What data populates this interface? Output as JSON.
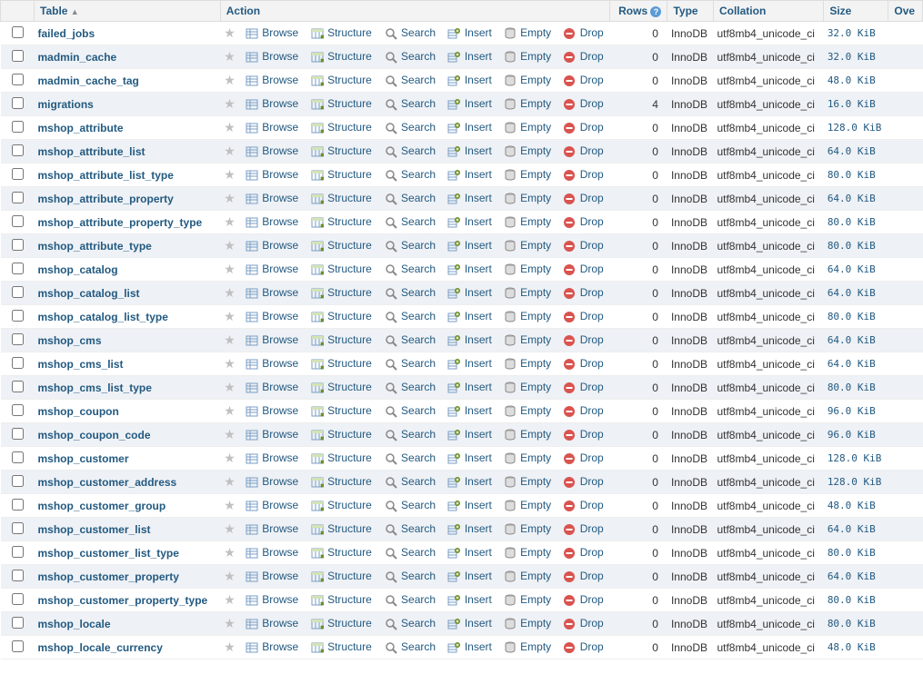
{
  "headers": {
    "table": "Table",
    "action": "Action",
    "rows": "Rows",
    "type": "Type",
    "collation": "Collation",
    "size": "Size",
    "overhead": "Ove"
  },
  "actions": {
    "browse": "Browse",
    "structure": "Structure",
    "search": "Search",
    "insert": "Insert",
    "empty": "Empty",
    "drop": "Drop"
  },
  "tables": [
    {
      "name": "failed_jobs",
      "rows": 0,
      "type": "InnoDB",
      "collation": "utf8mb4_unicode_ci",
      "size": "32.0 KiB"
    },
    {
      "name": "madmin_cache",
      "rows": 0,
      "type": "InnoDB",
      "collation": "utf8mb4_unicode_ci",
      "size": "32.0 KiB"
    },
    {
      "name": "madmin_cache_tag",
      "rows": 0,
      "type": "InnoDB",
      "collation": "utf8mb4_unicode_ci",
      "size": "48.0 KiB"
    },
    {
      "name": "migrations",
      "rows": 4,
      "type": "InnoDB",
      "collation": "utf8mb4_unicode_ci",
      "size": "16.0 KiB"
    },
    {
      "name": "mshop_attribute",
      "rows": 0,
      "type": "InnoDB",
      "collation": "utf8mb4_unicode_ci",
      "size": "128.0 KiB"
    },
    {
      "name": "mshop_attribute_list",
      "rows": 0,
      "type": "InnoDB",
      "collation": "utf8mb4_unicode_ci",
      "size": "64.0 KiB"
    },
    {
      "name": "mshop_attribute_list_type",
      "rows": 0,
      "type": "InnoDB",
      "collation": "utf8mb4_unicode_ci",
      "size": "80.0 KiB"
    },
    {
      "name": "mshop_attribute_property",
      "rows": 0,
      "type": "InnoDB",
      "collation": "utf8mb4_unicode_ci",
      "size": "64.0 KiB"
    },
    {
      "name": "mshop_attribute_property_type",
      "rows": 0,
      "type": "InnoDB",
      "collation": "utf8mb4_unicode_ci",
      "size": "80.0 KiB"
    },
    {
      "name": "mshop_attribute_type",
      "rows": 0,
      "type": "InnoDB",
      "collation": "utf8mb4_unicode_ci",
      "size": "80.0 KiB"
    },
    {
      "name": "mshop_catalog",
      "rows": 0,
      "type": "InnoDB",
      "collation": "utf8mb4_unicode_ci",
      "size": "64.0 KiB"
    },
    {
      "name": "mshop_catalog_list",
      "rows": 0,
      "type": "InnoDB",
      "collation": "utf8mb4_unicode_ci",
      "size": "64.0 KiB"
    },
    {
      "name": "mshop_catalog_list_type",
      "rows": 0,
      "type": "InnoDB",
      "collation": "utf8mb4_unicode_ci",
      "size": "80.0 KiB"
    },
    {
      "name": "mshop_cms",
      "rows": 0,
      "type": "InnoDB",
      "collation": "utf8mb4_unicode_ci",
      "size": "64.0 KiB"
    },
    {
      "name": "mshop_cms_list",
      "rows": 0,
      "type": "InnoDB",
      "collation": "utf8mb4_unicode_ci",
      "size": "64.0 KiB"
    },
    {
      "name": "mshop_cms_list_type",
      "rows": 0,
      "type": "InnoDB",
      "collation": "utf8mb4_unicode_ci",
      "size": "80.0 KiB"
    },
    {
      "name": "mshop_coupon",
      "rows": 0,
      "type": "InnoDB",
      "collation": "utf8mb4_unicode_ci",
      "size": "96.0 KiB"
    },
    {
      "name": "mshop_coupon_code",
      "rows": 0,
      "type": "InnoDB",
      "collation": "utf8mb4_unicode_ci",
      "size": "96.0 KiB"
    },
    {
      "name": "mshop_customer",
      "rows": 0,
      "type": "InnoDB",
      "collation": "utf8mb4_unicode_ci",
      "size": "128.0 KiB"
    },
    {
      "name": "mshop_customer_address",
      "rows": 0,
      "type": "InnoDB",
      "collation": "utf8mb4_unicode_ci",
      "size": "128.0 KiB"
    },
    {
      "name": "mshop_customer_group",
      "rows": 0,
      "type": "InnoDB",
      "collation": "utf8mb4_unicode_ci",
      "size": "48.0 KiB"
    },
    {
      "name": "mshop_customer_list",
      "rows": 0,
      "type": "InnoDB",
      "collation": "utf8mb4_unicode_ci",
      "size": "64.0 KiB"
    },
    {
      "name": "mshop_customer_list_type",
      "rows": 0,
      "type": "InnoDB",
      "collation": "utf8mb4_unicode_ci",
      "size": "80.0 KiB"
    },
    {
      "name": "mshop_customer_property",
      "rows": 0,
      "type": "InnoDB",
      "collation": "utf8mb4_unicode_ci",
      "size": "64.0 KiB"
    },
    {
      "name": "mshop_customer_property_type",
      "rows": 0,
      "type": "InnoDB",
      "collation": "utf8mb4_unicode_ci",
      "size": "80.0 KiB"
    },
    {
      "name": "mshop_locale",
      "rows": 0,
      "type": "InnoDB",
      "collation": "utf8mb4_unicode_ci",
      "size": "80.0 KiB"
    },
    {
      "name": "mshop_locale_currency",
      "rows": 0,
      "type": "InnoDB",
      "collation": "utf8mb4_unicode_ci",
      "size": "48.0 KiB"
    }
  ]
}
